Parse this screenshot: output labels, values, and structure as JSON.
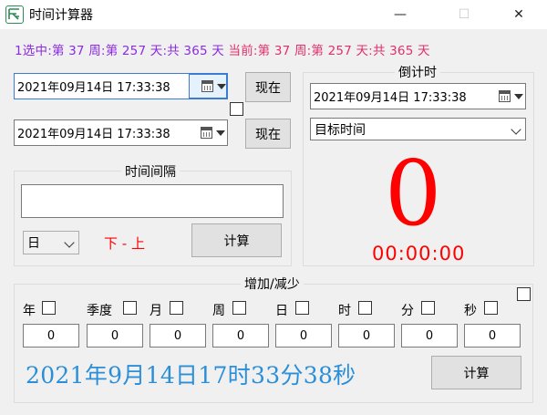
{
  "window": {
    "title": "时间计算器",
    "minimize": "—",
    "maximize": "☐",
    "close": "✕"
  },
  "info": {
    "selected_prefix": "1选中:",
    "selected_week_pre": "第",
    "selected_week": "37",
    "selected_week_post": "周:",
    "selected_day_pre": "第",
    "selected_day": "257",
    "selected_day_post": "天:",
    "selected_total_pre": "共",
    "selected_total": "365",
    "selected_total_post": "天",
    "current_prefix": "当前:",
    "current_week_pre": "第",
    "current_week": "37",
    "current_week_post": "周:",
    "current_day_pre": "第",
    "current_day": "257",
    "current_day_post": "天:",
    "current_total_pre": "共",
    "current_total": "365",
    "current_total_post": "天"
  },
  "start_date": {
    "value": "2021年09月14日  17:33:38",
    "now_label": "现在"
  },
  "end_date": {
    "value": "2021年09月14日  17:33:38",
    "now_label": "现在"
  },
  "interval": {
    "title": "时间间隔",
    "result": "",
    "unit": "日",
    "direction": "下 - 上",
    "calc_label": "计算"
  },
  "countdown": {
    "title": "倒计时",
    "target_datetime": "2021年09月14日  17:33:38",
    "target_select": "目标时间",
    "big_number": "0",
    "time_remaining": "00:00:00"
  },
  "add_subtract": {
    "title": "增加/减少",
    "units": [
      {
        "label": "年",
        "value": "0"
      },
      {
        "label": "季度",
        "value": "0"
      },
      {
        "label": "月",
        "value": "0"
      },
      {
        "label": "周",
        "value": "0"
      },
      {
        "label": "日",
        "value": "0"
      },
      {
        "label": "时",
        "value": "0"
      },
      {
        "label": "分",
        "value": "0"
      },
      {
        "label": "秒",
        "value": "0"
      }
    ],
    "result_text": "2021年9月14日17时33分38秒",
    "calc_label": "计算"
  },
  "colors": {
    "purple": "#8b2be2",
    "pink": "#e0306a",
    "red": "#ff0000",
    "blue": "#2b8fd8"
  }
}
